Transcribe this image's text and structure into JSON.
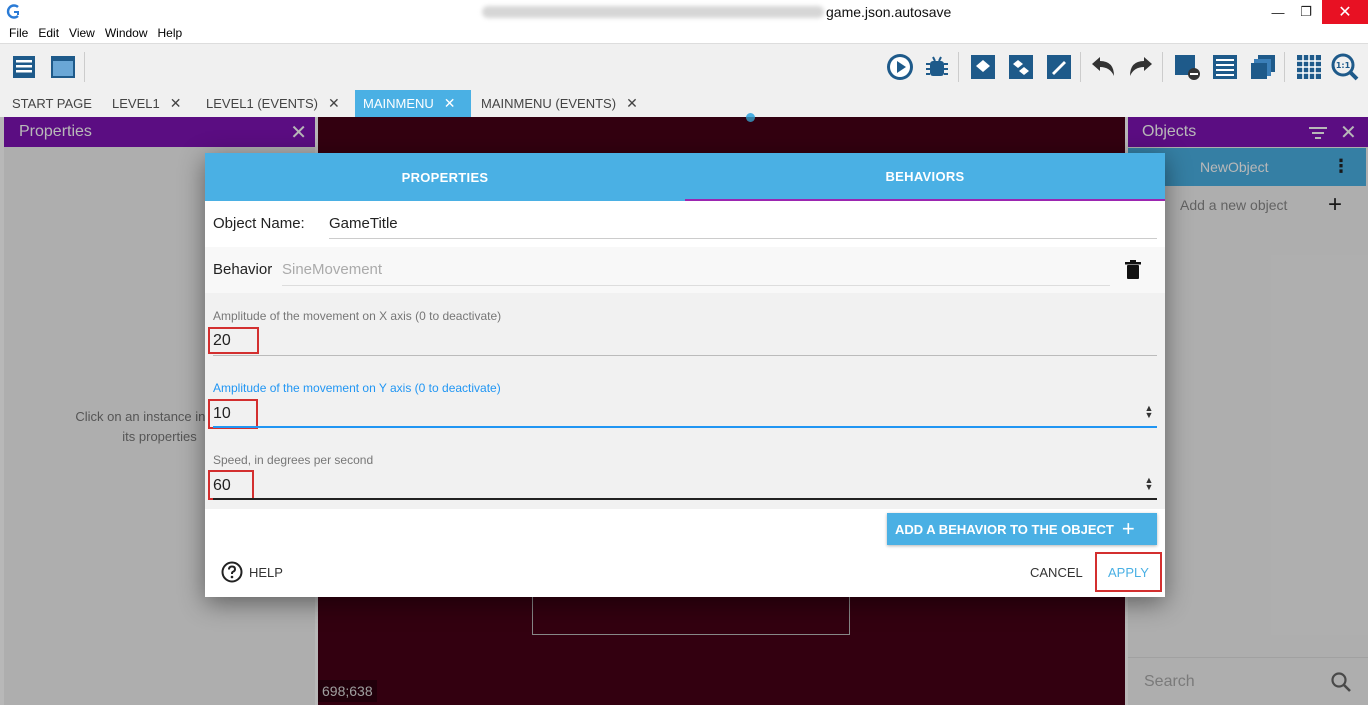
{
  "window": {
    "title": "game.json.autosave",
    "minimize": "—",
    "maximize": "❐",
    "close": "✕"
  },
  "menu": [
    "File",
    "Edit",
    "View",
    "Window",
    "Help"
  ],
  "tabs": [
    {
      "label": "START PAGE"
    },
    {
      "label": "LEVEL1",
      "close": "✕"
    },
    {
      "label": "LEVEL1 (EVENTS)",
      "close": "✕"
    },
    {
      "label": "MAINMENU",
      "close": "✕",
      "active": true
    },
    {
      "label": "MAINMENU (EVENTS)",
      "close": "✕"
    }
  ],
  "properties_panel": {
    "title": "Properties",
    "close": "✕",
    "hint_line1": "Click on an instance in the sc",
    "hint_line2": "its properties"
  },
  "scene": {
    "coords": "698;638"
  },
  "objects_panel": {
    "title": "Objects",
    "close": "✕",
    "item": "NewObject",
    "item_menu": "⋮",
    "add_label": "Add a new object",
    "add_icon": "+",
    "search_placeholder": "Search"
  },
  "dialog": {
    "tab_properties": "PROPERTIES",
    "tab_behaviors": "BEHAVIORS",
    "object_name_label": "Object Name:",
    "object_name_value": "GameTitle",
    "behavior_label": "Behavior",
    "behavior_value": "SineMovement",
    "fields": [
      {
        "label": "Amplitude of the movement on X axis (0 to deactivate)",
        "value": "20"
      },
      {
        "label": "Amplitude of the movement on Y axis (0 to deactivate)",
        "value": "10"
      },
      {
        "label": "Speed, in degrees per second",
        "value": "60"
      }
    ],
    "add_behavior_label": "ADD A BEHAVIOR TO THE OBJECT",
    "add_behavior_icon": "+",
    "help_label": "HELP",
    "cancel_label": "CANCEL",
    "apply_label": "APPLY"
  },
  "colors": {
    "accent": "#4ab0e4",
    "panel_header": "#7e13b5",
    "scene_bg": "#470017",
    "highlight_box": "#d32f2f"
  }
}
